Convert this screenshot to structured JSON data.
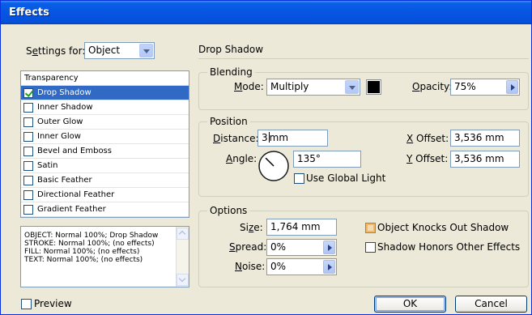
{
  "window": {
    "title": "Effects"
  },
  "settings": {
    "label_pre": "S",
    "label_u": "e",
    "label_post": "ttings for:",
    "value": "Object"
  },
  "list": {
    "header": "Transparency",
    "items": [
      {
        "label": "Drop Shadow",
        "checked": true,
        "selected": true
      },
      {
        "label": "Inner Shadow",
        "checked": false
      },
      {
        "label": "Outer Glow",
        "checked": false
      },
      {
        "label": "Inner Glow",
        "checked": false
      },
      {
        "label": "Bevel and Emboss",
        "checked": false
      },
      {
        "label": "Satin",
        "checked": false
      },
      {
        "label": "Basic Feather",
        "checked": false
      },
      {
        "label": "Directional Feather",
        "checked": false
      },
      {
        "label": "Gradient Feather",
        "checked": false
      }
    ]
  },
  "summary": [
    "OBJECT: Normal 100%; Drop Shadow",
    "STROKE: Normal 100%; (no effects)",
    "FILL: Normal 100%; (no effects)",
    "TEXT: Normal 100%; (no effects)"
  ],
  "preview": {
    "label": "Preview",
    "checked": false
  },
  "panel": {
    "title": "Drop Shadow"
  },
  "blending": {
    "title": "Blending",
    "mode_u": "M",
    "mode_rest": "ode:",
    "mode_value": "Multiply",
    "color": "#000000",
    "opacity_u": "O",
    "opacity_rest": "pacity:",
    "opacity_value": "75%"
  },
  "position": {
    "title": "Position",
    "distance_u": "D",
    "distance_rest": "istance:",
    "distance_pre": "3",
    "distance_post": "mm",
    "angle_u": "A",
    "angle_rest": "ngle:",
    "angle_value": "135°",
    "angle_deg": 135,
    "global_light": "Use Global Light",
    "global_light_checked": false,
    "x_u": "X",
    "x_rest": " Offset:",
    "x_value": "3,536 mm",
    "y_u": "Y",
    "y_rest": " Offset:",
    "y_value": "3,536 mm"
  },
  "options": {
    "title": "Options",
    "size_pre": "Si",
    "size_u": "z",
    "size_post": "e:",
    "size_value": "1,764 mm",
    "spread_u": "S",
    "spread_rest": "pread:",
    "spread_value": "0%",
    "noise_u": "N",
    "noise_rest": "oise:",
    "noise_value": "0%",
    "knocks_out": "Object Knocks Out Shadow",
    "knocks_out_checked": true,
    "honors": "Shadow Honors Other Effects",
    "honors_checked": false
  },
  "buttons": {
    "ok": "OK",
    "cancel": "Cancel"
  }
}
